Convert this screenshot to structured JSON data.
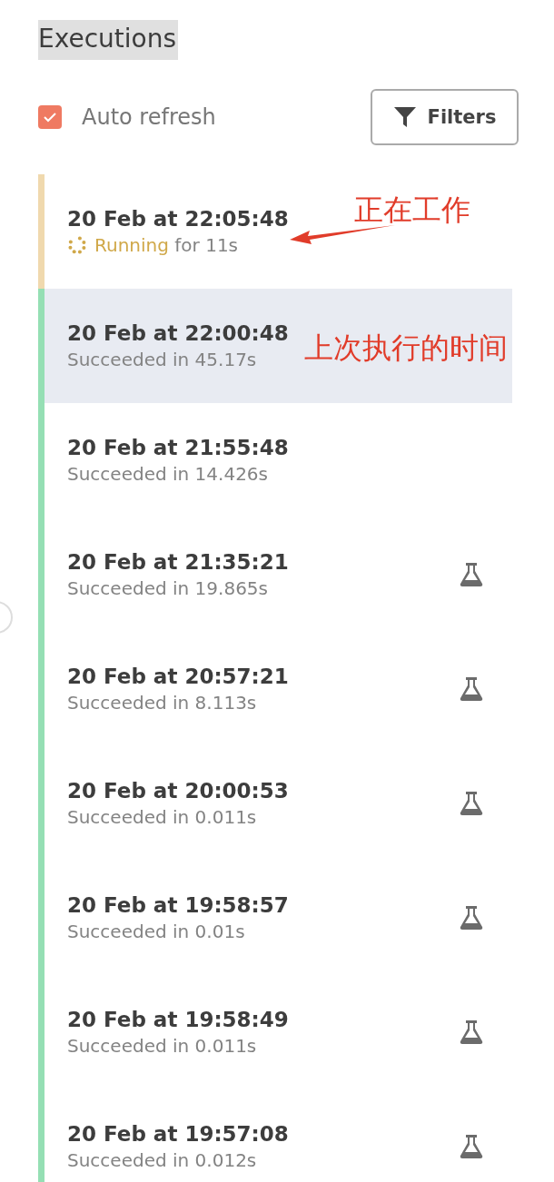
{
  "title": "Executions",
  "auto_refresh": {
    "label": "Auto refresh",
    "checked": true
  },
  "filters_button": "Filters",
  "executions": [
    {
      "time": "20 Feb at 22:05:48",
      "kind": "running",
      "status": "Running",
      "detail": "for 11s",
      "selected": false,
      "test": false,
      "annotation": "正在工作"
    },
    {
      "time": "20 Feb at 22:00:48",
      "kind": "succeeded",
      "status": "Succeeded in 45.17s",
      "selected": true,
      "test": false,
      "annotation": "上次执行的时间"
    },
    {
      "time": "20 Feb at 21:55:48",
      "kind": "succeeded",
      "status": "Succeeded in 14.426s",
      "selected": false,
      "test": false
    },
    {
      "time": "20 Feb at 21:35:21",
      "kind": "succeeded",
      "status": "Succeeded in 19.865s",
      "selected": false,
      "test": true
    },
    {
      "time": "20 Feb at 20:57:21",
      "kind": "succeeded",
      "status": "Succeeded in 8.113s",
      "selected": false,
      "test": true
    },
    {
      "time": "20 Feb at 20:00:53",
      "kind": "succeeded",
      "status": "Succeeded in 0.011s",
      "selected": false,
      "test": true
    },
    {
      "time": "20 Feb at 19:58:57",
      "kind": "succeeded",
      "status": "Succeeded in 0.01s",
      "selected": false,
      "test": true
    },
    {
      "time": "20 Feb at 19:58:49",
      "kind": "succeeded",
      "status": "Succeeded in 0.011s",
      "selected": false,
      "test": true
    },
    {
      "time": "20 Feb at 19:57:08",
      "kind": "succeeded",
      "status": "Succeeded in 0.012s",
      "selected": false,
      "test": true
    }
  ]
}
